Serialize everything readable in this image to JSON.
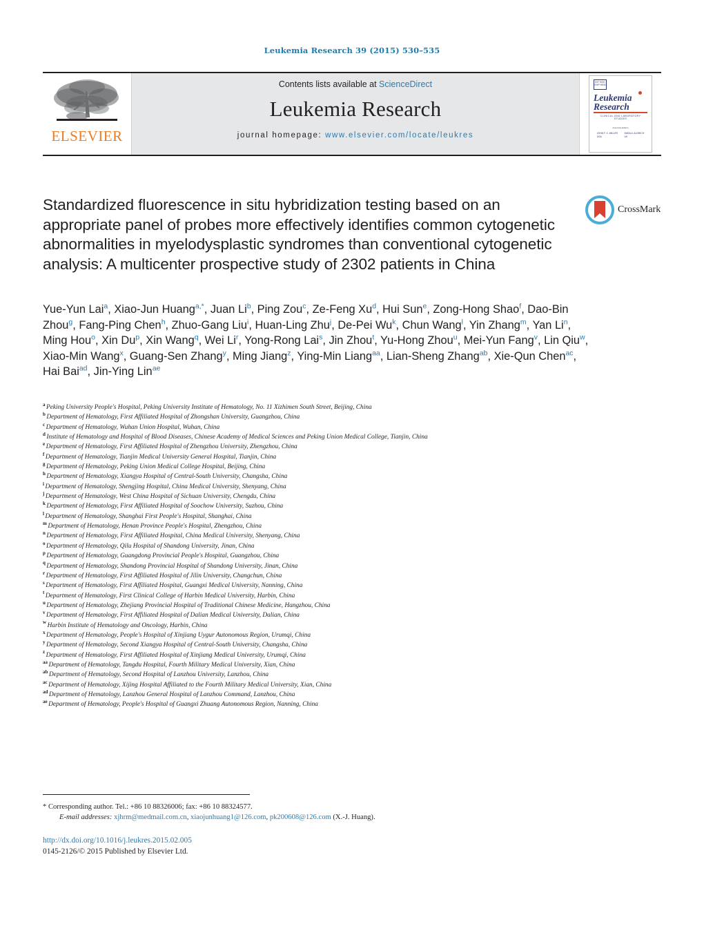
{
  "running_head": "Leukemia Research 39 (2015) 530–535",
  "masthead": {
    "contents_prefix": "Contents lists available at ",
    "contents_link": "ScienceDirect",
    "journal_name": "Leukemia Research",
    "homepage_label": "journal homepage:",
    "homepage_url": "www.elsevier.com/locate/leukres",
    "publisher_logo_text": "ELSEVIER",
    "cover": {
      "badge_text": "INT SOC EXP HEM",
      "title_line1": "Leukemia",
      "title_line2": "Research",
      "subtitle": "CLINICAL AND LABORATORY STUDIES",
      "association": "Associate Editors",
      "editor_left": "JOHN F. X. MILLER",
      "editor_left_city": "USA",
      "editor_right": "SARA A. ALDRICH",
      "editor_right_city": "UK"
    }
  },
  "article": {
    "title": "Standardized fluorescence in situ hybridization testing based on an appropriate panel of probes more effectively identifies common cytogenetic abnormalities in myelodysplastic syndromes than conventional cytogenetic analysis: A multicenter prospective study of 2302 patients in China",
    "crossmark_label": "CrossMark"
  },
  "authors": [
    {
      "name": "Yue-Yun Lai",
      "marks": "a"
    },
    {
      "name": "Xiao-Jun Huang",
      "marks": "a,*"
    },
    {
      "name": "Juan Li",
      "marks": "b"
    },
    {
      "name": "Ping Zou",
      "marks": "c"
    },
    {
      "name": "Ze-Feng Xu",
      "marks": "d"
    },
    {
      "name": "Hui Sun",
      "marks": "e"
    },
    {
      "name": "Zong-Hong Shao",
      "marks": "f"
    },
    {
      "name": "Dao-Bin Zhou",
      "marks": "g"
    },
    {
      "name": "Fang-Ping Chen",
      "marks": "h"
    },
    {
      "name": "Zhuo-Gang Liu",
      "marks": "i"
    },
    {
      "name": "Huan-Ling Zhu",
      "marks": "j"
    },
    {
      "name": "De-Pei Wu",
      "marks": "k"
    },
    {
      "name": "Chun Wang",
      "marks": "l"
    },
    {
      "name": "Yin Zhang",
      "marks": "m"
    },
    {
      "name": "Yan Li",
      "marks": "n"
    },
    {
      "name": "Ming Hou",
      "marks": "o"
    },
    {
      "name": "Xin Du",
      "marks": "p"
    },
    {
      "name": "Xin Wang",
      "marks": "q"
    },
    {
      "name": "Wei Li",
      "marks": "r"
    },
    {
      "name": "Yong-Rong Lai",
      "marks": "s"
    },
    {
      "name": "Jin Zhou",
      "marks": "t"
    },
    {
      "name": "Yu-Hong Zhou",
      "marks": "u"
    },
    {
      "name": "Mei-Yun Fang",
      "marks": "v"
    },
    {
      "name": "Lin Qiu",
      "marks": "w"
    },
    {
      "name": "Xiao-Min Wang",
      "marks": "x"
    },
    {
      "name": "Guang-Sen Zhang",
      "marks": "y"
    },
    {
      "name": "Ming Jiang",
      "marks": "z"
    },
    {
      "name": "Ying-Min Liang",
      "marks": "aa"
    },
    {
      "name": "Lian-Sheng Zhang",
      "marks": "ab"
    },
    {
      "name": "Xie-Qun Chen",
      "marks": "ac"
    },
    {
      "name": "Hai Bai",
      "marks": "ad"
    },
    {
      "name": "Jin-Ying Lin",
      "marks": "ae"
    }
  ],
  "affiliations": [
    {
      "mark": "a",
      "text": "Peking University People's Hospital, Peking University Institute of Hematology, No. 11 Xizhimen South Street, Beijing, China"
    },
    {
      "mark": "b",
      "text": "Department of Hematology, First Affiliated Hospital of Zhongshan University, Guangzhou, China"
    },
    {
      "mark": "c",
      "text": "Department of Hematology, Wuhan Union Hospital, Wuhan, China"
    },
    {
      "mark": "d",
      "text": "Institute of Hematology and Hospital of Blood Diseases, Chinese Academy of Medical Sciences and Peking Union Medical College, Tianjin, China"
    },
    {
      "mark": "e",
      "text": "Department of Hematology, First Affiliated Hospital of Zhengzhou University, Zhengzhou, China"
    },
    {
      "mark": "f",
      "text": "Department of Hematology, Tianjin Medical University General Hospital, Tianjin, China"
    },
    {
      "mark": "g",
      "text": "Department of Hematology, Peking Union Medical College Hospital, Beijing, China"
    },
    {
      "mark": "h",
      "text": "Department of Hematology, Xiangya Hospital of Central-South University, Changsha, China"
    },
    {
      "mark": "i",
      "text": "Department of Hematology, Shengjing Hospital, China Medical University, Shenyang, China"
    },
    {
      "mark": "j",
      "text": "Department of Hematology, West China Hospital of Sichuan University, Chengdu, China"
    },
    {
      "mark": "k",
      "text": "Department of Hematology, First Affiliated Hospital of Soochow University, Suzhou, China"
    },
    {
      "mark": "l",
      "text": "Department of Hematology, Shanghai First People's Hospital, Shanghai, China"
    },
    {
      "mark": "m",
      "text": "Department of Hematology, Henan Province People's Hospital, Zhengzhou, China"
    },
    {
      "mark": "n",
      "text": "Department of Hematology, First Affiliated Hospital, China Medical University, Shenyang, China"
    },
    {
      "mark": "o",
      "text": "Department of Hematology, Qilu Hospital of Shandong University, Jinan, China"
    },
    {
      "mark": "p",
      "text": "Department of Hematology, Guangdong Provincial People's Hospital, Guangzhou, China"
    },
    {
      "mark": "q",
      "text": "Department of Hematology, Shandong Provincial Hospital of Shandong University, Jinan, China"
    },
    {
      "mark": "r",
      "text": "Department of Hematology, First Affiliated Hospital of Jilin University, Changchun, China"
    },
    {
      "mark": "s",
      "text": "Department of Hematology, First Affiliated Hospital, Guangxi Medical University, Nanning, China"
    },
    {
      "mark": "t",
      "text": "Department of Hematology, First Clinical College of Harbin Medical University, Harbin, China"
    },
    {
      "mark": "u",
      "text": "Department of Hematology, Zhejiang Provincial Hospital of Traditional Chinese Medicine, Hangzhou, China"
    },
    {
      "mark": "v",
      "text": "Department of Hematology, First Affiliated Hospital of Dalian Medical University, Dalian, China"
    },
    {
      "mark": "w",
      "text": "Harbin Institute of Hematology and Oncology, Harbin, China"
    },
    {
      "mark": "x",
      "text": "Department of Hematology, People's Hospital of Xinjiang Uygur Autonomous Region, Urumqi, China"
    },
    {
      "mark": "y",
      "text": "Department of Hematology, Second Xiangya Hospital of Central-South University, Changsha, China"
    },
    {
      "mark": "z",
      "text": "Department of Hematology, First Affiliated Hospital of Xinjiang Medical University, Urumqi, China"
    },
    {
      "mark": "aa",
      "text": "Department of Hematology, Tangdu Hospital, Fourth Military Medical University, Xian, China"
    },
    {
      "mark": "ab",
      "text": "Department of Hematology, Second Hospital of Lanzhou University, Lanzhou, China"
    },
    {
      "mark": "ac",
      "text": "Department of Hematology, Xijing Hospital Affiliated to the Fourth Military Medical University, Xian, China"
    },
    {
      "mark": "ad",
      "text": "Department of Hematology, Lanzhou General Hospital of Lanzhou Command, Lanzhou, China"
    },
    {
      "mark": "ae",
      "text": "Department of Hematology, People's Hospital of Guangxi Zhuang Autonomous Region, Nanning, China"
    }
  ],
  "footnotes": {
    "corresponding": "* Corresponding author. Tel.: +86 10 88326006; fax: +86 10 88324577.",
    "email_label": "E-mail addresses:",
    "emails": [
      "xjhrm@medmail.com.cn",
      "xiaojunhuang1@126.com",
      "pk200608@126.com"
    ],
    "email_suffix": "(X.-J. Huang)."
  },
  "doi": "http://dx.doi.org/10.1016/j.leukres.2015.02.005",
  "copyright": "0145-2126/© 2015 Published by Elsevier Ltd.",
  "colors": {
    "link": "#2a7ab0",
    "elsevier_orange": "#eb7c23",
    "cover_navy": "#2d3a73",
    "masthead_grey": "#e6e7e8"
  }
}
